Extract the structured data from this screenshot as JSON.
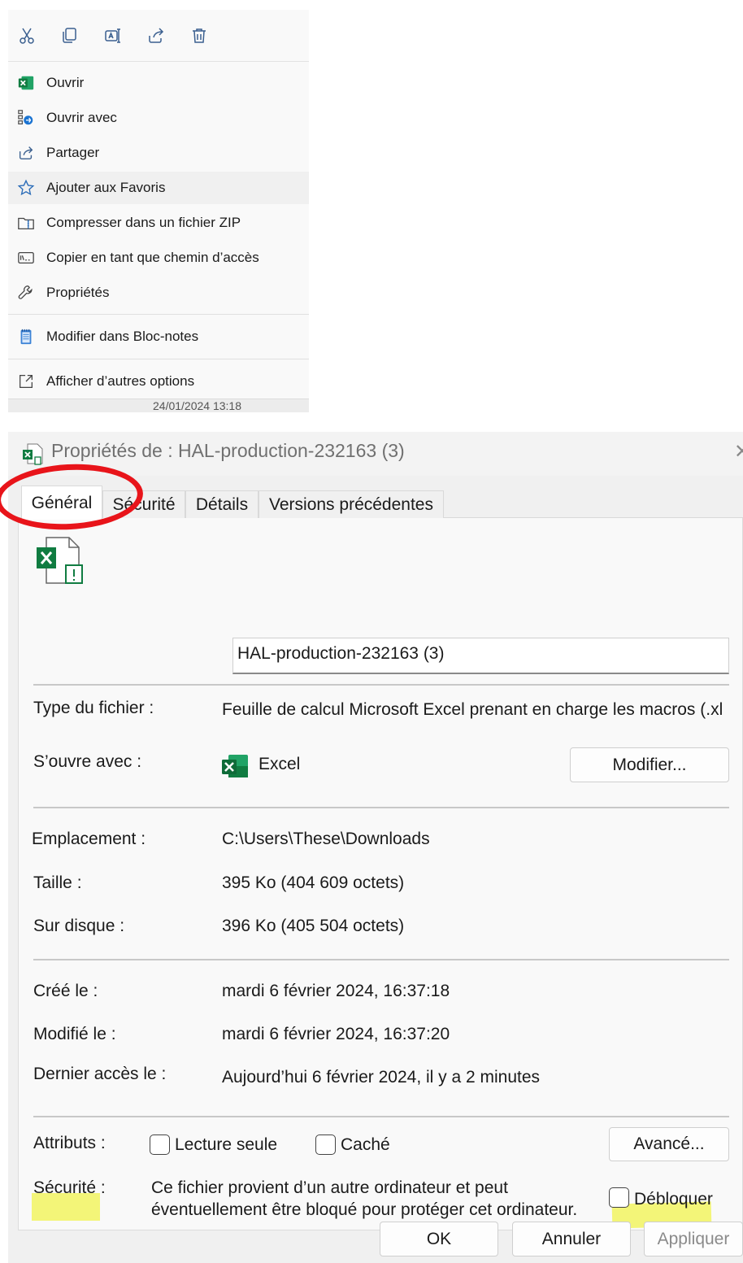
{
  "context_menu": {
    "toolbar": [
      {
        "icon": "scissors-icon",
        "tooltip": "cut"
      },
      {
        "icon": "copy-icon",
        "tooltip": "copy"
      },
      {
        "icon": "rename-icon",
        "tooltip": "rename"
      },
      {
        "icon": "share-icon",
        "tooltip": "share"
      },
      {
        "icon": "trash-icon",
        "tooltip": "delete"
      }
    ],
    "items": [
      {
        "label": "Ouvrir",
        "icon": "excel-icon"
      },
      {
        "label": "Ouvrir avec",
        "icon": "open-with-icon"
      },
      {
        "label": "Partager",
        "icon": "share-icon"
      },
      {
        "label": "Ajouter aux Favoris",
        "icon": "star-icon"
      },
      {
        "label": "Compresser dans un fichier ZIP",
        "icon": "zip-folder-icon"
      },
      {
        "label": "Copier en tant que chemin d’accès",
        "icon": "path-icon"
      },
      {
        "label": "Propriétés",
        "icon": "wrench-icon"
      },
      {
        "label": "Modifier dans Bloc-notes",
        "icon": "notepad-icon"
      },
      {
        "label": "Afficher d’autres options",
        "icon": "more-options-icon"
      }
    ],
    "background_date": "24/01/2024 13:18"
  },
  "properties": {
    "title": "Propriétés de : HAL-production-232163 (3)",
    "tabs": [
      "Général",
      "Sécurité",
      "Détails",
      "Versions précédentes"
    ],
    "file_name": "HAL-production-232163 (3)",
    "file_type_label": "Type du fichier :",
    "file_type_value": "Feuille de calcul Microsoft Excel prenant en charge les macros (.xl",
    "opens_with_label": "S’ouvre avec :",
    "opens_with_value": "Excel",
    "change_button": "Modifier...",
    "location_label": "Emplacement :",
    "location_value": "C:\\Users\\These\\Downloads",
    "size_label": "Taille :",
    "size_value": "395 Ko (404 609 octets)",
    "disk_label": "Sur disque :",
    "disk_value": "396 Ko (405 504 octets)",
    "created_label": "Créé le :",
    "created_value": "mardi 6 février 2024, 16:37:18",
    "modified_label": "Modifié le :",
    "modified_value": "mardi 6 février 2024, 16:37:20",
    "accessed_label": "Dernier accès le :",
    "accessed_value": "Aujourd’hui 6 février 2024, il y a 2 minutes",
    "attributes_label": "Attributs :",
    "readonly_label": "Lecture seule",
    "readonly_checked": false,
    "hidden_label": "Caché",
    "hidden_checked": false,
    "advanced_button": "Avancé...",
    "security_label": "Sécurité :",
    "security_line1": "Ce fichier provient d’un autre ordinateur et peut",
    "security_line2": "éventuellement être bloqué pour protéger cet ordinateur.",
    "unblock_label": "Débloquer",
    "unblock_checked": false,
    "ok_button": "OK",
    "cancel_button": "Annuler",
    "apply_button": "Appliquer"
  },
  "annotations": {
    "circle_color": "#e8141a",
    "highlight_color": "#f2f562"
  }
}
